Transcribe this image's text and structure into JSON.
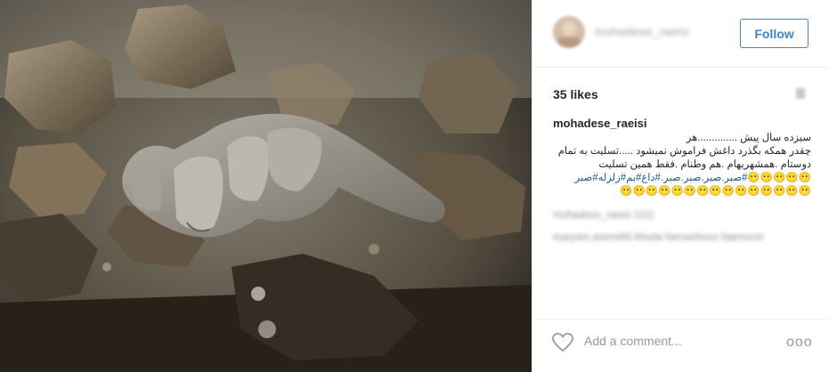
{
  "post": {
    "username": "mohadese_raeisi",
    "follow_label": "Follow",
    "likes": "35 likes",
    "caption_lines": [
      "سیزده سال پیش ..............هر",
      "چقدر همکه بگذرد داغش فراموش نمیشود .....تسلیت به تمام",
      "دوستام .همشهریهام .هم وطنام .فقط همین تسلیت",
      "😶😶😶😶😶#صبر.صبر.صبر.صبر.#داغ#بم#زلزله#صبر",
      "😶😶😶😶😶😶😶😶😶😶😶😶😶😶😶"
    ],
    "blurred_comment_1": "mohadese_raeisi 1111",
    "blurred_comment_2": "maryam.asemi66 khoda hamashono biamorze",
    "add_comment_placeholder": "Add a comment...",
    "more_label": "ooo"
  },
  "colors": {
    "accent": "#3f86c8",
    "hashtag": "#1f5a8e",
    "muted": "#999999"
  },
  "icons": [
    "heart-icon",
    "more-options-icon",
    "avatar"
  ]
}
